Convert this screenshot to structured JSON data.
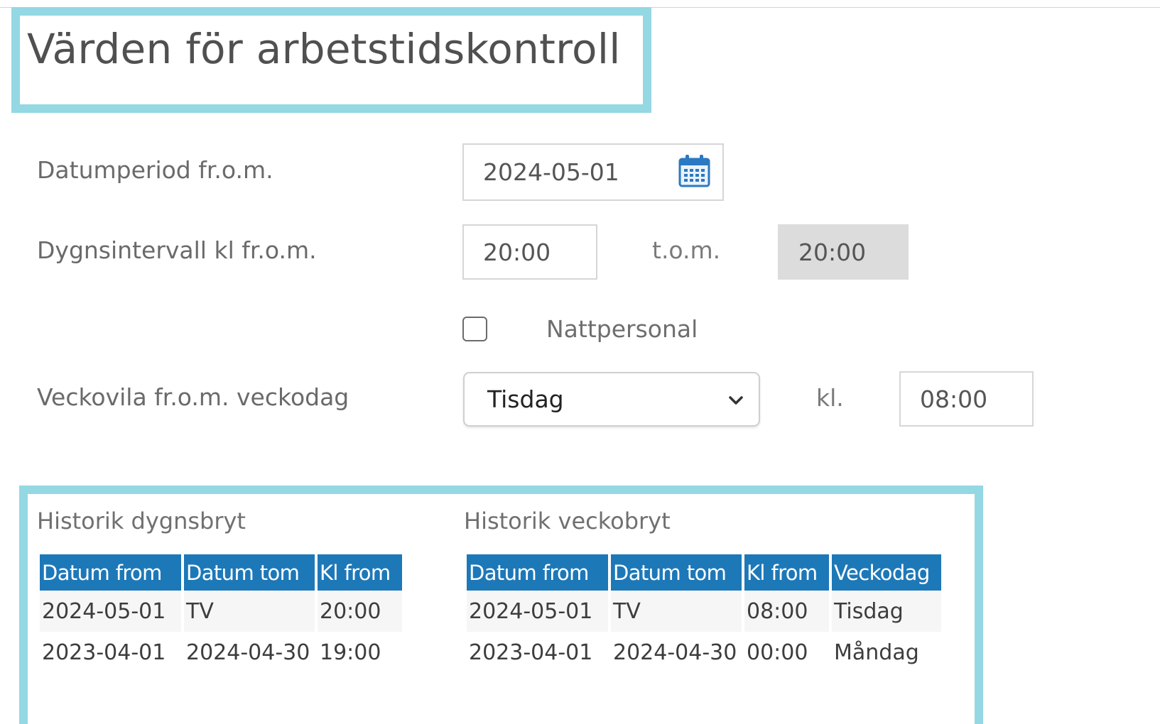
{
  "form": {
    "title": "Värden för arbetstidskontroll",
    "date_period": {
      "label": "Datumperiod fr.o.m.",
      "value": "2024-05-01",
      "icon": "calendar-icon"
    },
    "day_interval": {
      "label": "Dygnsintervall kl fr.o.m.",
      "from_value": "20:00",
      "to_label": "t.o.m.",
      "to_value": "20:00"
    },
    "night_staff": {
      "label": "Nattpersonal",
      "checked": false
    },
    "weekly_rest": {
      "label": "Veckovila fr.o.m. veckodag",
      "selected_day": "Tisdag",
      "time_label": "kl.",
      "time_value": "08:00",
      "icon": "chevron-down-icon"
    }
  },
  "history": {
    "daily_breaks": {
      "heading": "Historik dygnsbryt",
      "columns": [
        "Datum from",
        "Datum tom",
        "Kl from"
      ],
      "rows": [
        [
          "2024-05-01",
          "TV",
          "20:00"
        ],
        [
          "2023-04-01",
          "2024-04-30",
          "19:00"
        ]
      ]
    },
    "weekly_breaks": {
      "heading": "Historik veckobryt",
      "columns": [
        "Datum from",
        "Datum tom",
        "Kl from",
        "Veckodag"
      ],
      "rows": [
        [
          "2024-05-01",
          "TV",
          "08:00",
          "Tisdag"
        ],
        [
          "2023-04-01",
          "2024-04-30",
          "00:00",
          "Måndag"
        ]
      ]
    }
  },
  "colors": {
    "highlight_frame": "#93d8e3",
    "table_header": "#1d78b8",
    "readonly_field": "#dcdcdc"
  }
}
